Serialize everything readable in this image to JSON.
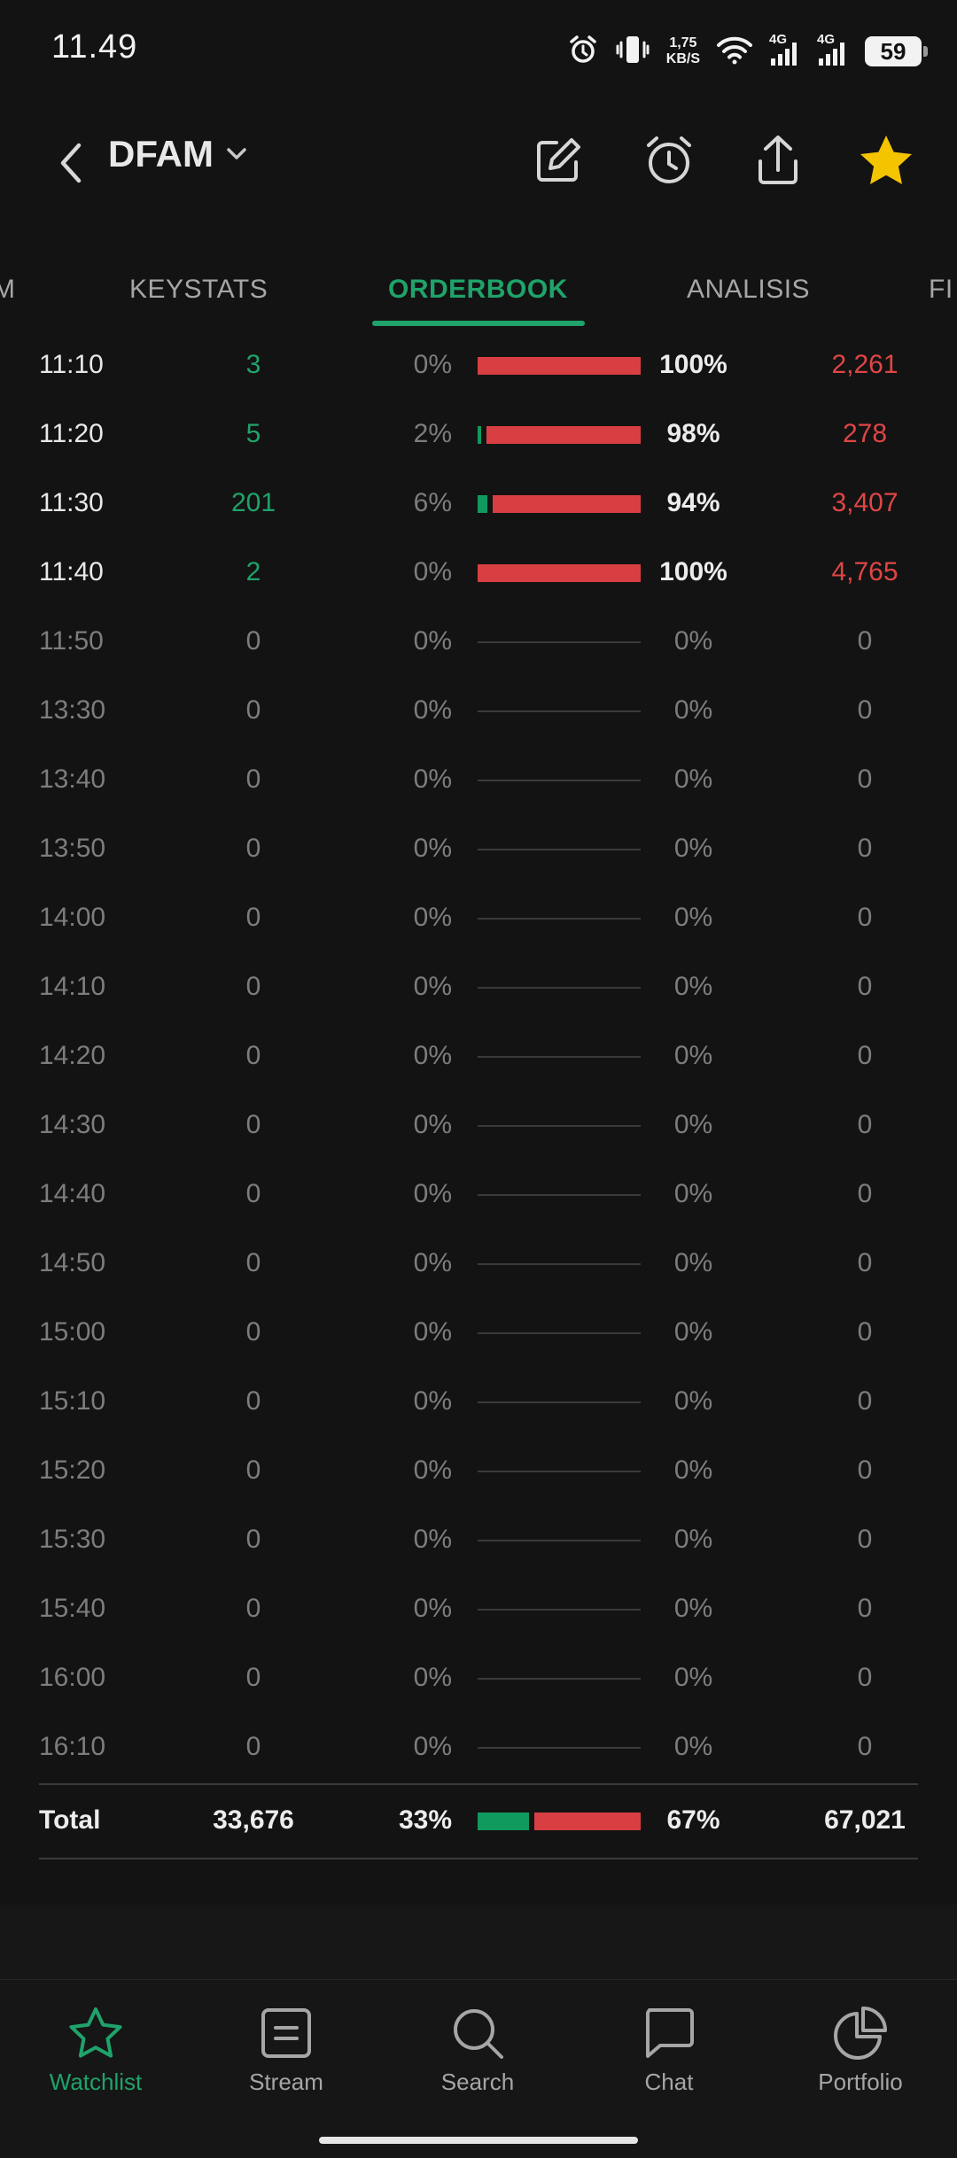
{
  "status_bar": {
    "time": "11.49",
    "net_speed_value": "1,75",
    "net_speed_unit": "KB/S",
    "signal1": "4G",
    "signal2": "4G",
    "battery": "59"
  },
  "header": {
    "ticker": "DFAM",
    "colors": {
      "star": "#f5c400",
      "accent": "#1fa36a"
    }
  },
  "tabs": [
    {
      "label": "M"
    },
    {
      "label": "KEYSTATS"
    },
    {
      "label": "ORDERBOOK",
      "active": true
    },
    {
      "label": "ANALISIS"
    },
    {
      "label": "FI"
    }
  ],
  "rows": [
    {
      "time": "11:10",
      "buy": "3",
      "buy_pct": "0%",
      "sell_pct": "100%",
      "sell": "2,261",
      "buy_frac": 0.0,
      "sell_frac": 1.0,
      "active": true
    },
    {
      "time": "11:20",
      "buy": "5",
      "buy_pct": "2%",
      "sell_pct": "98%",
      "sell": "278",
      "buy_frac": 0.02,
      "sell_frac": 0.98,
      "active": true
    },
    {
      "time": "11:30",
      "buy": "201",
      "buy_pct": "6%",
      "sell_pct": "94%",
      "sell": "3,407",
      "buy_frac": 0.06,
      "sell_frac": 0.94,
      "active": true
    },
    {
      "time": "11:40",
      "buy": "2",
      "buy_pct": "0%",
      "sell_pct": "100%",
      "sell": "4,765",
      "buy_frac": 0.0,
      "sell_frac": 1.0,
      "active": true
    },
    {
      "time": "11:50",
      "buy": "0",
      "buy_pct": "0%",
      "sell_pct": "0%",
      "sell": "0",
      "buy_frac": 0,
      "sell_frac": 0,
      "active": false
    },
    {
      "time": "13:30",
      "buy": "0",
      "buy_pct": "0%",
      "sell_pct": "0%",
      "sell": "0",
      "buy_frac": 0,
      "sell_frac": 0,
      "active": false
    },
    {
      "time": "13:40",
      "buy": "0",
      "buy_pct": "0%",
      "sell_pct": "0%",
      "sell": "0",
      "buy_frac": 0,
      "sell_frac": 0,
      "active": false
    },
    {
      "time": "13:50",
      "buy": "0",
      "buy_pct": "0%",
      "sell_pct": "0%",
      "sell": "0",
      "buy_frac": 0,
      "sell_frac": 0,
      "active": false
    },
    {
      "time": "14:00",
      "buy": "0",
      "buy_pct": "0%",
      "sell_pct": "0%",
      "sell": "0",
      "buy_frac": 0,
      "sell_frac": 0,
      "active": false
    },
    {
      "time": "14:10",
      "buy": "0",
      "buy_pct": "0%",
      "sell_pct": "0%",
      "sell": "0",
      "buy_frac": 0,
      "sell_frac": 0,
      "active": false
    },
    {
      "time": "14:20",
      "buy": "0",
      "buy_pct": "0%",
      "sell_pct": "0%",
      "sell": "0",
      "buy_frac": 0,
      "sell_frac": 0,
      "active": false
    },
    {
      "time": "14:30",
      "buy": "0",
      "buy_pct": "0%",
      "sell_pct": "0%",
      "sell": "0",
      "buy_frac": 0,
      "sell_frac": 0,
      "active": false
    },
    {
      "time": "14:40",
      "buy": "0",
      "buy_pct": "0%",
      "sell_pct": "0%",
      "sell": "0",
      "buy_frac": 0,
      "sell_frac": 0,
      "active": false
    },
    {
      "time": "14:50",
      "buy": "0",
      "buy_pct": "0%",
      "sell_pct": "0%",
      "sell": "0",
      "buy_frac": 0,
      "sell_frac": 0,
      "active": false
    },
    {
      "time": "15:00",
      "buy": "0",
      "buy_pct": "0%",
      "sell_pct": "0%",
      "sell": "0",
      "buy_frac": 0,
      "sell_frac": 0,
      "active": false
    },
    {
      "time": "15:10",
      "buy": "0",
      "buy_pct": "0%",
      "sell_pct": "0%",
      "sell": "0",
      "buy_frac": 0,
      "sell_frac": 0,
      "active": false
    },
    {
      "time": "15:20",
      "buy": "0",
      "buy_pct": "0%",
      "sell_pct": "0%",
      "sell": "0",
      "buy_frac": 0,
      "sell_frac": 0,
      "active": false
    },
    {
      "time": "15:30",
      "buy": "0",
      "buy_pct": "0%",
      "sell_pct": "0%",
      "sell": "0",
      "buy_frac": 0,
      "sell_frac": 0,
      "active": false
    },
    {
      "time": "15:40",
      "buy": "0",
      "buy_pct": "0%",
      "sell_pct": "0%",
      "sell": "0",
      "buy_frac": 0,
      "sell_frac": 0,
      "active": false
    },
    {
      "time": "16:00",
      "buy": "0",
      "buy_pct": "0%",
      "sell_pct": "0%",
      "sell": "0",
      "buy_frac": 0,
      "sell_frac": 0,
      "active": false
    },
    {
      "time": "16:10",
      "buy": "0",
      "buy_pct": "0%",
      "sell_pct": "0%",
      "sell": "0",
      "buy_frac": 0,
      "sell_frac": 0,
      "active": false
    }
  ],
  "total": {
    "label": "Total",
    "buy": "33,676",
    "buy_pct": "33%",
    "sell_pct": "67%",
    "sell": "67,021",
    "buy_frac": 0.33,
    "sell_frac": 0.67
  },
  "bottom_nav": [
    {
      "label": "Watchlist",
      "icon": "star-outline-icon",
      "active": true
    },
    {
      "label": "Stream",
      "icon": "stream-icon"
    },
    {
      "label": "Search",
      "icon": "search-icon"
    },
    {
      "label": "Chat",
      "icon": "chat-icon"
    },
    {
      "label": "Portfolio",
      "icon": "pie-chart-icon"
    }
  ]
}
